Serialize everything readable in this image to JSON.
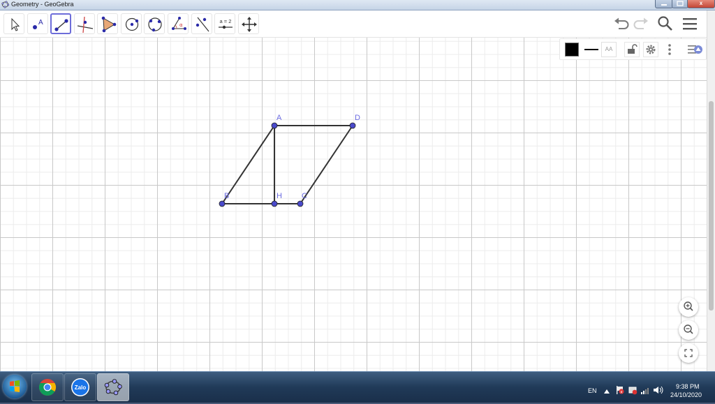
{
  "window": {
    "title": "Geometry - GeoGebra",
    "close_glyph": "x"
  },
  "toolbar": {
    "tools": [
      {
        "name": "move-tool",
        "icon": "cursor-arrow-icon"
      },
      {
        "name": "point-tool",
        "icon": "point-a-icon",
        "label": "A"
      },
      {
        "name": "segment-tool",
        "icon": "segment-icon",
        "selected": true
      },
      {
        "name": "perpendicular-line-tool",
        "icon": "perpendicular-lines-icon"
      },
      {
        "name": "polygon-tool",
        "icon": "polygon-icon"
      },
      {
        "name": "circle-tool",
        "icon": "circle-center-icon"
      },
      {
        "name": "circle-through-points-tool",
        "icon": "circle-three-points-icon"
      },
      {
        "name": "angle-tool",
        "icon": "angle-icon",
        "label": "α"
      },
      {
        "name": "reflect-tool",
        "icon": "reflect-line-icon"
      },
      {
        "name": "slider-tool",
        "icon": "slider-icon",
        "label": "a = 2"
      },
      {
        "name": "move-graphics-view-tool",
        "icon": "move-arrows-icon"
      }
    ],
    "right_icons": [
      "undo-icon",
      "redo-icon",
      "search-icon",
      "menu-icon"
    ]
  },
  "style_bar": {
    "color": "#000000",
    "text_size_label": "AA",
    "icons": [
      "color-swatch-icon",
      "line-style-icon",
      "text-size-icon",
      "lock-icon",
      "gear-icon",
      "more-vertical-icon",
      "style-bar-toggle-icon"
    ]
  },
  "figure": {
    "point_color": "#4a4acb",
    "segment_color": "#333333",
    "label_color": "#6a6ae0",
    "points": [
      {
        "label": "A"
      },
      {
        "label": "D"
      },
      {
        "label": "B"
      },
      {
        "label": "H"
      },
      {
        "label": "C"
      }
    ],
    "segments": [
      "AB",
      "AD",
      "AH",
      "BC",
      "CD"
    ]
  },
  "zoom_controls": [
    "zoom-in-icon",
    "zoom-out-icon",
    "fullscreen-icon"
  ],
  "taskbar": {
    "apps": [
      "chrome-icon",
      "zalo-icon",
      "geogebra-icon"
    ],
    "zalo_label": "Zalo",
    "language": "EN",
    "time": "9:38 PM",
    "date": "24/10/2020"
  }
}
